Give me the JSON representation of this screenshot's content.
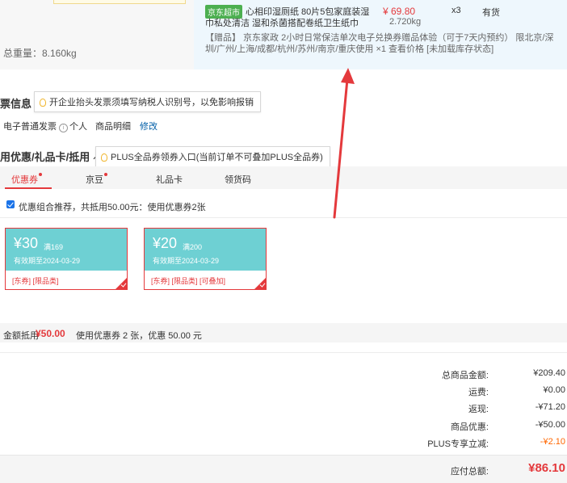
{
  "product": {
    "total_weight": "总重量：8.160kg",
    "badge": "京东超市",
    "name_line1": "心相印湿厕纸 80片5包家庭装湿",
    "name_line2": "巾私处清洁 湿和杀菌搭配卷纸卫生纸巾",
    "price": "¥ 69.80",
    "weight": "2.720kg",
    "qty": "x3",
    "stock": "有货",
    "gift": "【赠品】 京东家政 2小时日常保洁单次电子兑换券赠品体验（可于7天内预约） 限北京/深圳/广州/上海/成都/杭州/苏州/南京/重庆使用 ×1  查看价格 [未加载库存状态]"
  },
  "invoice": {
    "title": "票信息",
    "tip": "开企业抬头发票须填写纳税人识别号，以免影响报销",
    "type": "电子普通发票",
    "info_icon": "i",
    "person": "个人",
    "detail": "商品明细",
    "edit": "修改"
  },
  "discount": {
    "title": "用优惠/礼品卡/抵用",
    "plus_tip": "PLUS全品券领券入口(当前订单不可叠加PLUS全品券)",
    "tabs": [
      "优惠券",
      "京豆",
      "礼品卡",
      "领货码"
    ],
    "combo_text": "优惠组合推荐，共抵用50.00元：使用优惠券2张",
    "coupons": [
      {
        "amount": "¥30",
        "condition": "满169",
        "valid": "有效期至2024-03-29",
        "tags": "[东券] [限品类]"
      },
      {
        "amount": "¥20",
        "condition": "满200",
        "valid": "有效期至2024-03-29",
        "tags": "[东券] [限品类] [可叠加]"
      }
    ],
    "summary_label": "金额抵用",
    "summary_amount": "¥50.00",
    "summary_desc": "使用优惠券 2 张，优惠 50.00 元"
  },
  "totals": {
    "rows": [
      {
        "label": "总商品金额:",
        "value": "¥209.40"
      },
      {
        "label": "运费:",
        "value": "¥0.00"
      },
      {
        "label": "返现:",
        "value": "-¥71.20"
      },
      {
        "label": "商品优惠:",
        "value": "-¥50.00"
      },
      {
        "label": "PLUS专享立减:",
        "value": "-¥2.10"
      }
    ],
    "pay_label": "应付总额:",
    "pay_value": "¥86.10"
  },
  "colors": {
    "accent": "#e4393c",
    "coupon_face": "#6ed0d3",
    "link": "#005ea7",
    "plus_discount": "#ff6600"
  }
}
